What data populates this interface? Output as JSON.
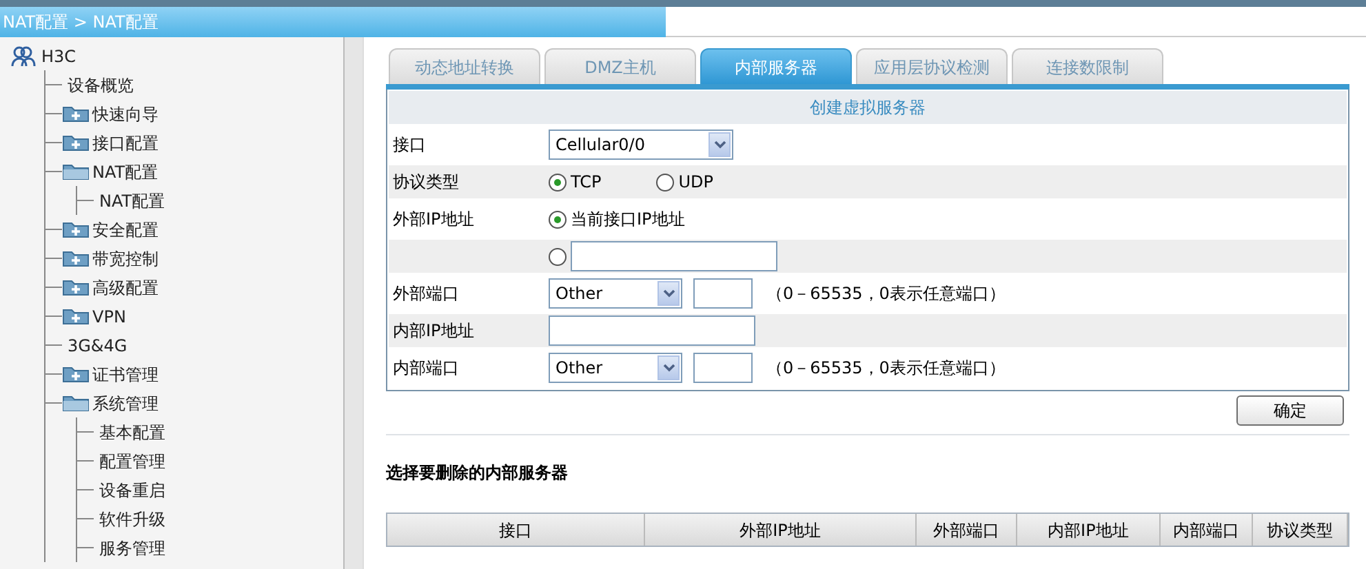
{
  "breadcrumb": "NAT配置 > NAT配置",
  "tree": {
    "label": "H3C",
    "children": [
      {
        "label": "设备概览"
      },
      {
        "label": "快速向导",
        "expanded": false
      },
      {
        "label": "接口配置",
        "expanded": false
      },
      {
        "label": "NAT配置",
        "expanded": true,
        "children": [
          {
            "label": "NAT配置"
          }
        ]
      },
      {
        "label": "安全配置",
        "expanded": false
      },
      {
        "label": "带宽控制",
        "expanded": false
      },
      {
        "label": "高级配置",
        "expanded": false
      },
      {
        "label": "VPN",
        "expanded": false
      },
      {
        "label": "3G&4G"
      },
      {
        "label": "证书管理",
        "expanded": false
      },
      {
        "label": "系统管理",
        "expanded": true,
        "children": [
          {
            "label": "基本配置"
          },
          {
            "label": "配置管理"
          },
          {
            "label": "设备重启"
          },
          {
            "label": "软件升级"
          },
          {
            "label": "服务管理"
          }
        ]
      }
    ]
  },
  "tabs": [
    {
      "label": "动态地址转换",
      "selected": false
    },
    {
      "label": "DMZ主机",
      "selected": false
    },
    {
      "label": "内部服务器",
      "selected": true
    },
    {
      "label": "应用层协议检测",
      "selected": false
    },
    {
      "label": "连接数限制",
      "selected": false
    }
  ],
  "form": {
    "title": "创建虚拟服务器",
    "rows": [
      {
        "kind": "select",
        "label": "接口",
        "value": "Cellular0/0"
      },
      {
        "kind": "radios",
        "label": "协议类型",
        "options": [
          {
            "label": "TCP",
            "selected": true
          },
          {
            "label": "UDP",
            "selected": false
          }
        ]
      },
      {
        "kind": "radios",
        "label": "外部IP地址",
        "options": [
          {
            "label": "当前接口IP地址",
            "selected": true
          }
        ]
      },
      {
        "kind": "radio-input",
        "selected": false
      },
      {
        "kind": "port",
        "label": "外部端口",
        "value": "Other",
        "hint": "（0－65535，0表示任意端口）"
      },
      {
        "kind": "input",
        "label": "内部IP地址"
      },
      {
        "kind": "port",
        "label": "内部端口",
        "value": "Other",
        "hint": "（0－65535，0表示任意端口）"
      }
    ],
    "submit": "确定"
  },
  "delete_section": {
    "title": "选择要删除的内部服务器",
    "columns": [
      "接口",
      "外部IP地址",
      "外部端口",
      "内部IP地址",
      "内部端口",
      "协议类型"
    ]
  }
}
